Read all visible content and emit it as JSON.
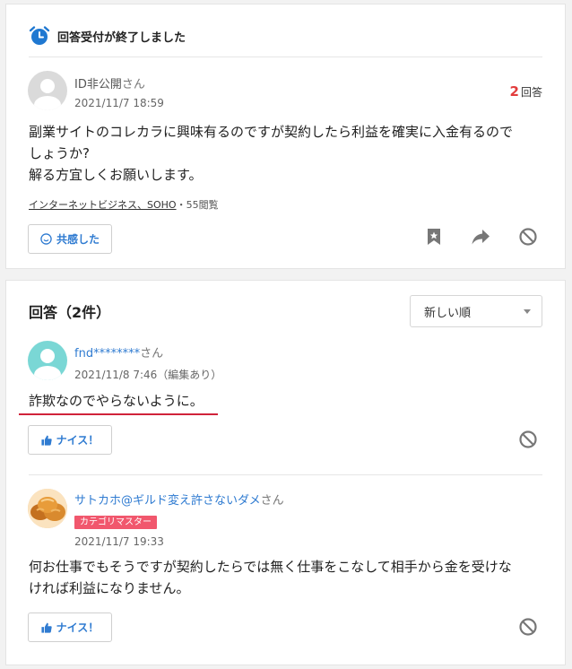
{
  "question": {
    "status_text": "回答受付が終了しました",
    "author_name": "ID非公開",
    "author_suffix": "さん",
    "date": "2021/11/7 18:59",
    "answer_count": "2",
    "answer_count_label": "回答",
    "body_lines": [
      "副業サイトのコレカラに興味有るのですが契約したら利益を確実に入金有るので",
      "しょうか?",
      "解る方宜しくお願いします。"
    ],
    "category": "インターネットビジネス、SOHO",
    "views": "・55閲覧",
    "empathy_label": "共感した"
  },
  "answers_section": {
    "title": "回答（2件）",
    "sort_selected": "新しい順"
  },
  "answers": [
    {
      "author_name": "fnd********",
      "author_suffix": "さん",
      "date": "2021/11/8 7:46（編集あり）",
      "body_lines": [
        "詐欺なのでやらないように。"
      ],
      "nice_label": "ナイス！"
    },
    {
      "author_name": "サトカホ@ギルド変え許さないダメ",
      "author_suffix": "さん",
      "badge": "カテゴリマスター",
      "date": "2021/11/7 19:33",
      "body_lines": [
        "何お仕事でもそうですが契約したらでは無く仕事をこなして相手から金を受けな",
        "ければ利益になりません。"
      ],
      "nice_label": "ナイス！"
    }
  ],
  "colors": {
    "accent_blue": "#2f7bd1",
    "count_red": "#e23c3c",
    "badge_pink": "#f1576d",
    "underline_red": "#d0233a"
  }
}
